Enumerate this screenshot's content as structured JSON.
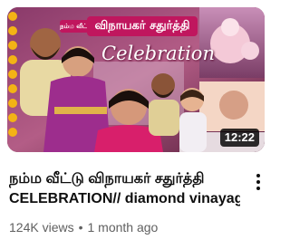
{
  "thumbnail": {
    "badge_small": "நம்ம வீட்டு",
    "badge_main": "விநாயகர் சதுர்த்தி",
    "script_text": "Celebration",
    "duration": "12:22"
  },
  "video": {
    "title_line1": "நம்ம வீட்டு விநாயகர் சதுர்த்தி",
    "title_line2": "CELEBRATION// diamond vinayaga...",
    "views": "124K views",
    "separator": "•",
    "age": "1 month ago"
  },
  "colors": {
    "badge": "#c0165e",
    "background": "#6a2a4a",
    "text": "#0f0f0f",
    "meta_text": "#606060"
  },
  "icons": {
    "more": "vertical-dots-icon"
  }
}
